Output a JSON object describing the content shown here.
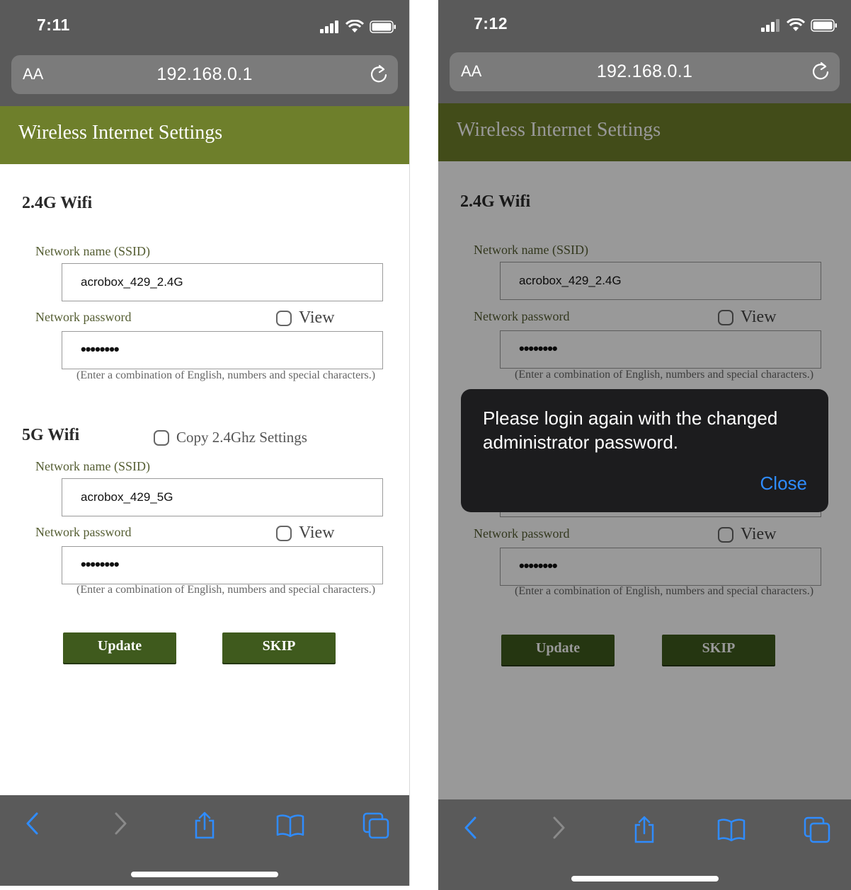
{
  "screens": [
    {
      "time": "7:11",
      "url": "192.168.0.1",
      "aa_label": "AA",
      "page_title": "Wireless Internet Settings",
      "wifi24": {
        "title": "2.4G Wifi",
        "ssid_label": "Network name (SSID)",
        "ssid_value": "acrobox_429_2.4G",
        "pw_label": "Network password",
        "view_label": "View",
        "pw_value": "••••••••",
        "hint": "(Enter a combination of English, numbers and special characters.)"
      },
      "wifi5": {
        "title": "5G Wifi",
        "copy_label": "Copy 2.4Ghz Settings",
        "ssid_label": "Network name (SSID)",
        "ssid_value": "acrobox_429_5G",
        "pw_label": "Network password",
        "view_label": "View",
        "pw_value": "••••••••",
        "hint": "(Enter a combination of English, numbers and special characters.)"
      },
      "update_label": "Update",
      "skip_label": "SKIP"
    },
    {
      "time": "7:12",
      "url": "192.168.0.1",
      "aa_label": "AA",
      "page_title": "Wireless Internet Settings",
      "wifi24": {
        "title": "2.4G Wifi",
        "ssid_label": "Network name (SSID)",
        "ssid_value": "acrobox_429_2.4G",
        "pw_label": "Network password",
        "view_label": "View",
        "pw_value": "••••••••",
        "hint": "(Enter a combination of English, numbers and special characters.)"
      },
      "wifi5": {
        "pw_label": "Network password",
        "view_label": "View",
        "pw_value": "••••••••",
        "hint": "(Enter a combination of English, numbers and special characters.)"
      },
      "update_label": "Update",
      "skip_label": "SKIP",
      "dialog": {
        "message": "Please login again with the changed administrator password.",
        "close_label": "Close"
      }
    }
  ],
  "colors": {
    "header": "#6e7f2b",
    "button": "#3f5a1d",
    "chrome": "#5a5a5a",
    "link_blue": "#2f8cff"
  },
  "icons": [
    "signal-icon",
    "wifi-icon",
    "battery-icon",
    "reload-icon",
    "back-icon",
    "forward-icon",
    "share-icon",
    "bookmarks-icon",
    "tabs-icon"
  ]
}
